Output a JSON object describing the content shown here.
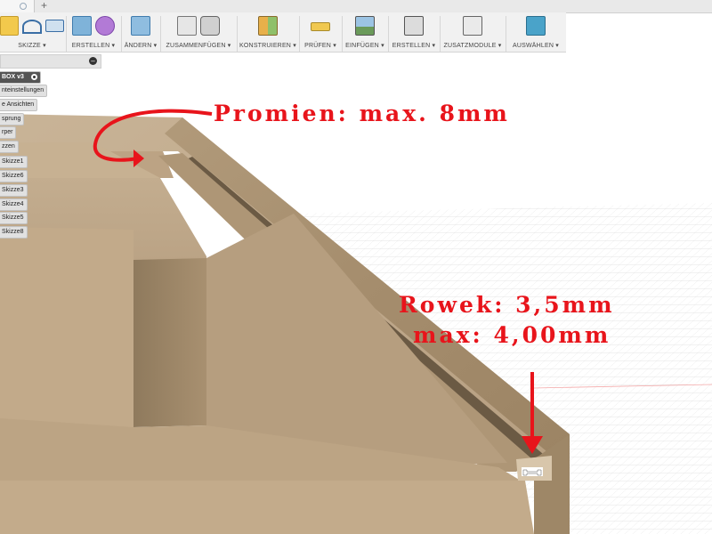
{
  "window": {
    "new_tab_glyph": "+"
  },
  "toolbar": {
    "groups": [
      {
        "label": "SKIZZE ▾"
      },
      {
        "label": "ERSTELLEN ▾"
      },
      {
        "label": "ÄNDERN ▾"
      },
      {
        "label": "ZUSAMMENFÜGEN ▾"
      },
      {
        "label": "KONSTRUIEREN ▾"
      },
      {
        "label": "PRÜFEN ▾"
      },
      {
        "label": "EINFÜGEN ▾"
      },
      {
        "label": "ERSTELLEN ▾"
      },
      {
        "label": "ZUSATZMODULE ▾"
      },
      {
        "label": "AUSWÄHLEN ▾"
      }
    ],
    "accent_color": "#4aa3c9"
  },
  "browser": {
    "collapse_glyph": "–",
    "document": "BOX v3",
    "items": [
      "nteinstellungen",
      "e Ansichten",
      "sprung",
      "rper",
      "zzen",
      "Skizze1",
      "Skizze6",
      "Skizze3",
      "Skizze4",
      "Skizze5",
      "Skizze8"
    ]
  },
  "annotations": {
    "promien": "Promien: max. 8mm",
    "rowek_line1": "Rowek: 3,5mm",
    "rowek_line2": "max: 4,00mm",
    "color": "#e8141b"
  }
}
